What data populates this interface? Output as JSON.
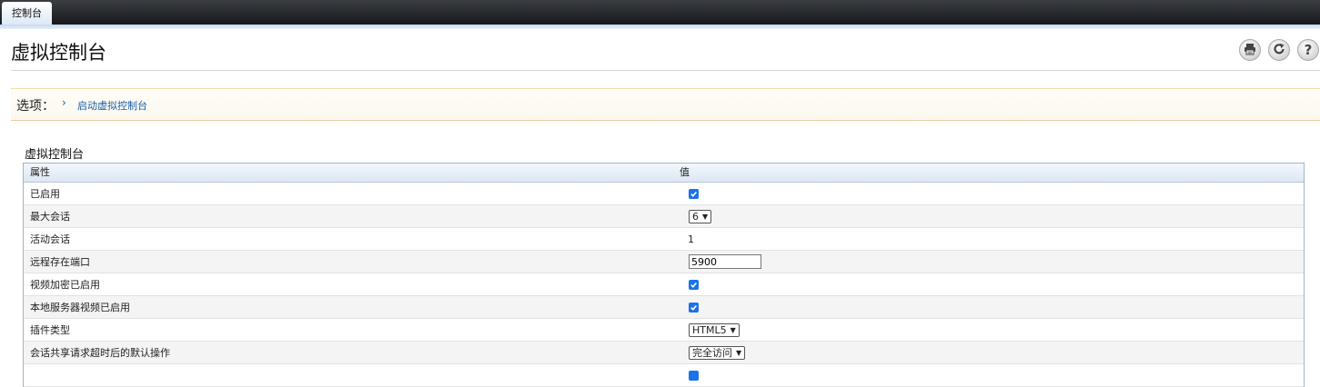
{
  "tabs": [
    {
      "label": "控制台",
      "active": true
    }
  ],
  "header": {
    "title": "虚拟控制台"
  },
  "options": {
    "label": "选项：",
    "links": [
      {
        "label": "启动虚拟控制台"
      }
    ]
  },
  "section": {
    "title": "虚拟控制台"
  },
  "table": {
    "columns": [
      "属性",
      "值"
    ],
    "rows": [
      {
        "label": "已启用",
        "type": "checkbox",
        "checked": true
      },
      {
        "label": "最大会话",
        "type": "select",
        "value": "6"
      },
      {
        "label": "活动会话",
        "type": "text",
        "value": "1"
      },
      {
        "label": "远程存在端口",
        "type": "input",
        "value": "5900"
      },
      {
        "label": "视频加密已启用",
        "type": "checkbox",
        "checked": true
      },
      {
        "label": "本地服务器视频已启用",
        "type": "checkbox",
        "checked": true
      },
      {
        "label": "插件类型",
        "type": "select",
        "value": "HTML5"
      },
      {
        "label": "会话共享请求超时后的默认操作",
        "type": "select",
        "value": "完全访问"
      }
    ]
  },
  "icons": {
    "print": "print-icon",
    "refresh": "refresh-icon",
    "help": "help-icon"
  },
  "colors": {
    "link": "#1a5fa8",
    "checkbox": "#1a73e8",
    "topbar": "#1f2226"
  }
}
